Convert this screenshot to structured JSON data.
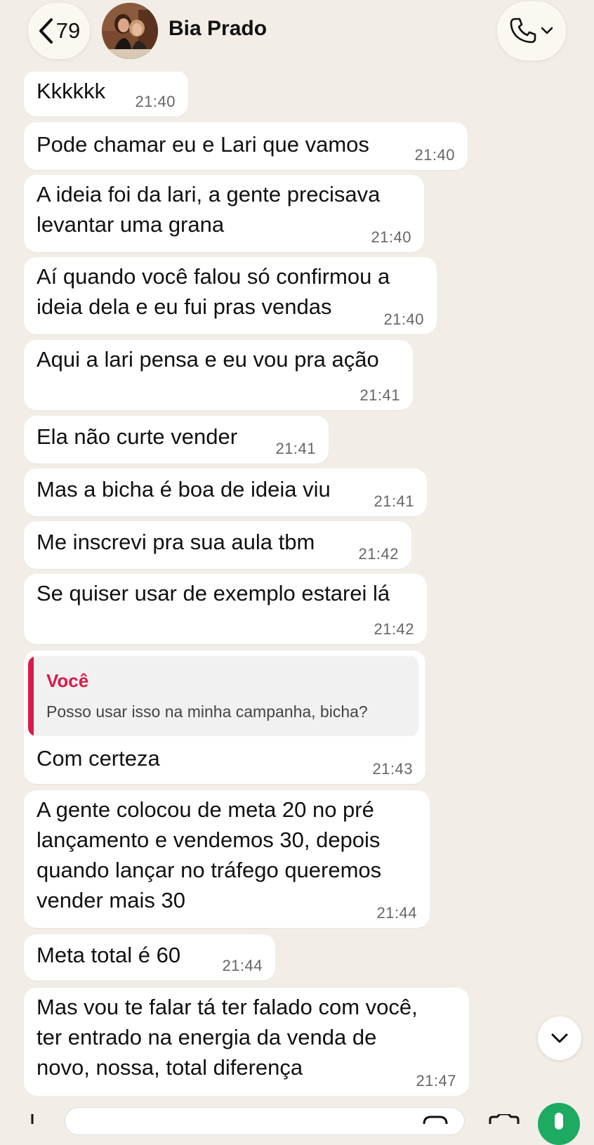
{
  "header": {
    "unread_count": "79",
    "contact_name": "Bia Prado"
  },
  "messages": [
    {
      "text": "Kkkkkk",
      "time": "21:40"
    },
    {
      "text": "Pode chamar eu e Lari que vamos",
      "time": "21:40"
    },
    {
      "text": "A ideia foi da lari, a gente precisava\nlevantar uma grana",
      "time": "21:40"
    },
    {
      "text": "Aí quando você falou só confirmou a\nideia dela e eu fui pras vendas",
      "time": "21:40"
    },
    {
      "text": "Aqui a lari pensa e eu vou pra ação",
      "time": "21:41"
    },
    {
      "text": "Ela não curte vender",
      "time": "21:41"
    },
    {
      "text": "Mas a bicha é boa de ideia viu",
      "time": "21:41"
    },
    {
      "text": "Me inscrevi pra sua aula tbm",
      "time": "21:42"
    },
    {
      "text": "Se quiser usar de exemplo estarei lá",
      "time": "21:42"
    },
    {
      "quote": {
        "author": "Você",
        "text": "Posso usar isso na minha campanha, bicha?"
      },
      "text": "Com certeza",
      "time": "21:43"
    },
    {
      "text": "A gente colocou de meta 20 no pré\nlançamento e vendemos 30, depois\nquando lançar no tráfego queremos\nvender mais 30",
      "time": "21:44"
    },
    {
      "text": "Meta total é 60",
      "time": "21:44"
    },
    {
      "text": "Mas vou te falar tá ter falado com você,\nter entrado na energia da venda de\nnovo, nossa, total diferença",
      "time": "21:47"
    }
  ],
  "colors": {
    "background": "#f2eee7",
    "bubble": "#ffffff",
    "quote_accent": "#d81b4a",
    "mic_button": "#1daa61"
  },
  "icons": {
    "back": "chevron-left-icon",
    "call": "phone-icon",
    "call_menu": "chevron-down-icon",
    "scroll": "chevron-down-icon",
    "attach": "plus-icon",
    "sticker": "sticker-icon",
    "camera": "camera-icon",
    "mic": "mic-icon"
  }
}
